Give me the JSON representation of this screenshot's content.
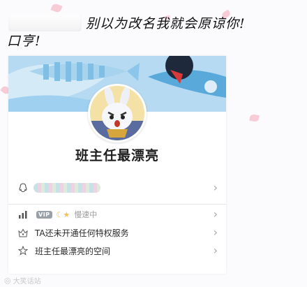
{
  "caption": {
    "line1": "别以为改名我就会原谅你!",
    "line2": "口亨!"
  },
  "profile": {
    "nickname": "班主任最漂亮"
  },
  "rows": {
    "vip": {
      "badge": "VIP",
      "status": "慢速中"
    },
    "privilege": {
      "label": "TA还未开通任何特权服务"
    },
    "space": {
      "label": "班主任最漂亮的空间"
    }
  },
  "watermark": {
    "text": "大笑话站"
  },
  "colors": {
    "banner": "#b6daf1",
    "fish_stripe": "#7fbfe6",
    "petal": "#f7c3cf"
  }
}
